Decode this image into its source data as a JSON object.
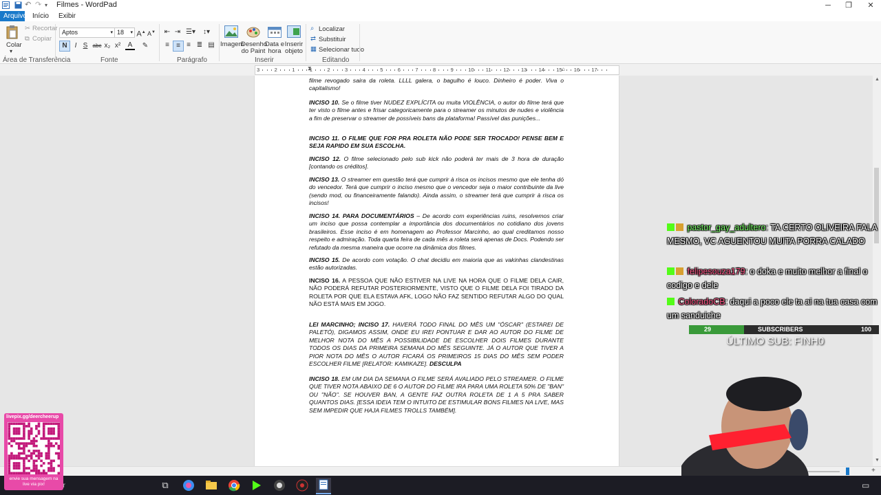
{
  "window": {
    "title": "Filmes - WordPad"
  },
  "tabs": [
    "Arquivo",
    "Início",
    "Exibir"
  ],
  "ribbon": {
    "clipboard": {
      "paste": "Colar",
      "cut": "Recortar",
      "copy": "Copiar",
      "group": "Área de Transferência"
    },
    "font": {
      "family": "Aptos",
      "size": "18",
      "group": "Fonte",
      "bold": "N",
      "italic": "I",
      "underline": "S",
      "strike": "abc",
      "subscript": "x₂",
      "superscript": "x²",
      "color": "A"
    },
    "paragraph": {
      "group": "Parágrafo"
    },
    "insert": {
      "image": "Imagem",
      "paint": "Desenho do Paint",
      "datetime": "Data e hora",
      "object": "Inserir objeto",
      "group": "Inserir"
    },
    "editing": {
      "find": "Localizar",
      "replace": "Substituir",
      "select_all": "Selecionar tudo",
      "group": "Editando"
    }
  },
  "ruler": {
    "marks": [
      "3",
      "2",
      "1",
      "1",
      "2",
      "3",
      "4",
      "5",
      "6",
      "7",
      "8",
      "9",
      "10",
      "11",
      "12",
      "13",
      "14",
      "15",
      "16",
      "17"
    ]
  },
  "document": {
    "top_fragment": "filme revogado saira da roleta. LLLL galera, o bagulho é louco. Dinheiro é poder. Viva o capitalismo!",
    "paragraphs": [
      {
        "lead": "INCISO 10.",
        "text": " Se o filme tiver NUDEZ EXPLÍCITA ou muita VIOLÊNCIA, o autor do filme terá que ter visto o filme antes e frisar categoricamente para o streamer os minutos de nudes e violência a fim de preservar o streamer de possíveis bans da plataforma! Passível das punições..."
      },
      {
        "lead": "INCISO 11. O FILME QUE FOR PRA ROLETA NÃO PODE SER TROCADO! PENSE BEM E SEJA RAPIDO EM SUA ESCOLHA.",
        "text": ""
      },
      {
        "lead": "INCISO 12.",
        "text": " O filme selecionado pelo sub kick não poderá ter mais de 3 hora de duração [contando os créditos]."
      },
      {
        "lead": "INCISO 13.",
        "text": " O streamer em questão terá que cumprir à risca os incisos mesmo que ele tenha dó do vencedor. Terá que cumprir o inciso mesmo que o vencedor seja o maior contribuinte da live (sendo mod, ou financeiramente falando). Ainda assim, o streamer terá que cumprir à risca os incisos!"
      },
      {
        "lead": "INCISO 14. PARA DOCUMENTÁRIOS",
        "text": " – De acordo com experiências ruins, resolvemos criar um inciso que possa contemplar a importância dos documentários no cotidiano dos jovens brasileiros. Esse inciso é em homenagem ao Professor Marcinho, ao qual creditamos nosso respeito e admiração. Toda quarta feira de cada mês a roleta será apenas de Docs. Podendo ser refutado da mesma maneira que ocorre na dinâmica dos filmes."
      },
      {
        "lead": "INCISO 15.",
        "text": " De acordo com votação. O chat decidiu em maioria que as vakinhas clandestinas estão autorizadas."
      },
      {
        "lead": "INCISO 16.",
        "text": " A PESSOA QUE NÃO ESTIVER NA LIVE NA HORA QUE O FILME DELA CAIR, NÃO PODERÁ REFUTAR POSTERIORMENTE, VISTO QUE O FILME DELA FOI TIRADO DA ROLETA POR QUE ELA ESTAVA AFK, LOGO NÃO FAZ SENTIDO REFUTAR ALGO DO QUAL NÃO ESTÁ MAIS EM JOGO."
      },
      {
        "lead": "LEI MARCINHO; INCISO 17.",
        "text": " HAVERÁ TODO FINAL DO MÊS UM \"ÓSCAR\" (ESTAREI DE PALETÓ), DIGAMOS ASSIM, ONDE EU IREI PONTUAR E DAR AO AUTOR DO FILME DE MELHOR NOTA DO MÊS A POSSIBILIDADE DE ESCOLHER DOIS FILMES DURANTE TODOS OS DIAS DA PRIMEIRA SEMANA DO MÊS SEGUINTE. JÁ O AUTOR QUE TIVER A PIOR NOTA DO MÊS O AUTOR FICARÁ OS PRIMEIROS 15 DIAS DO MÊS SEM PODER ESCOLHER FILME [RELATOR: KAMIKAZE].",
        "tail": " DESCULPA"
      },
      {
        "lead": "INCISO 18.",
        "text": " EM UM DIA DA SEMANA O FILME SERÁ AVALIADO PELO STREAMER. O FILME QUE TIVER NOTA ABAIXO DE 6 O AUTOR DO FILME IRA PARA UMA ROLETA 50% DE \"BAN\" OU \"NÃO\". SE HOUVER BAN, A GENTE FAZ OUTRA ROLETA DE 1 A 5 PRA SABER QUANTOS DIAS. [ESSA IDEIA TEM O INTUITO DE ESTIMULAR BONS FILMES NA LIVE, MAS SEM IMPEDIR QUE HAJA FILMES TROLLS TAMBÉM]."
      }
    ]
  },
  "chat": [
    {
      "user": "pastor_gay_adultero",
      "user_color": "#7cff6b",
      "message": ": TA CERTO OLIVEIRA FALA MESMO, VC AGUENTOU MUITA PORRA CALADO"
    },
    {
      "user": "felipesouza179",
      "user_color": "#ff5a8a",
      "message": ": o doka e muito melhor a final o codigo e dele"
    },
    {
      "user": "ColoradoCB",
      "user_color": "#ff5a8a",
      "message": ": daqui a poco ele ta ai na tua casa com um sanduiche"
    }
  ],
  "subs": {
    "current": "29",
    "label": "SUBSCRIBERS",
    "goal": "100",
    "last_sub": "ÚLTIMO SUB: FINH0"
  },
  "qr": {
    "top": "livepix.gg/deercheerup",
    "bottom": "envie sua mensagem na live via pix!"
  },
  "taskbar": {
    "search_fragment": "ar"
  },
  "colors": {
    "accent": "#1979ca",
    "kick_green": "#53fc18",
    "sub_bar": "#3a9a3a"
  }
}
